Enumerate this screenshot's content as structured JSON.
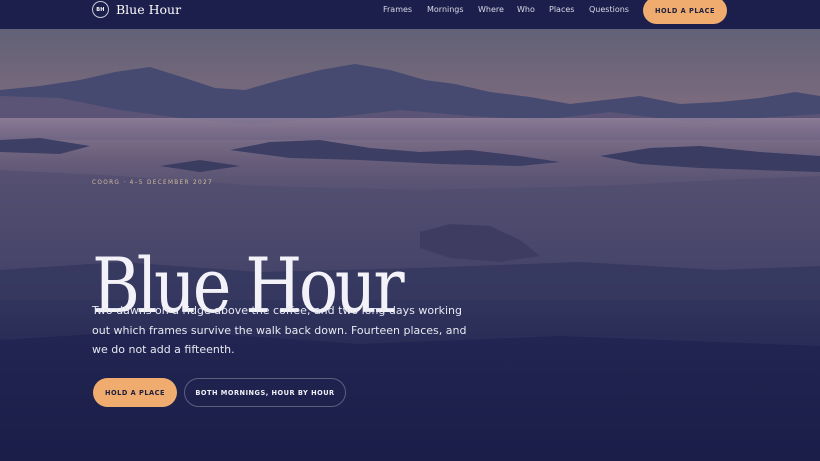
{
  "colors": {
    "navy": "#1c1f4c",
    "accent": "#f0ab6f"
  },
  "header": {
    "logo_badge": "BH",
    "logo_text": "Blue Hour",
    "nav": [
      "Frames",
      "Mornings",
      "Where",
      "Who",
      "Places",
      "Questions"
    ],
    "cta": "HOLD A PLACE"
  },
  "hero": {
    "eyebrow": "COORG · 4–5 DECEMBER 2027",
    "title": "Blue Hour",
    "lede": "Two dawns on a ridge above the coffee, and two long days working out which frames survive the walk back down. Fourteen places, and we do not add a fifteenth.",
    "primary_cta": "HOLD A PLACE",
    "secondary_cta": "BOTH MORNINGS, HOUR BY HOUR"
  }
}
